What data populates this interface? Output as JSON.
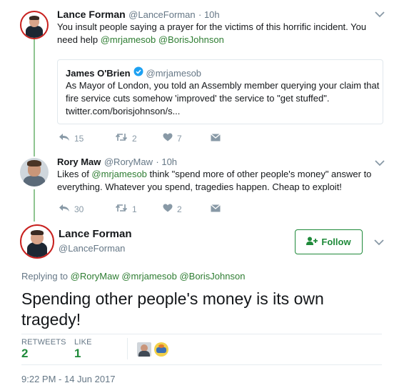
{
  "tweet1": {
    "name": "Lance Forman",
    "handle": "@LanceForman",
    "time": "· 10h",
    "text_line1": "You insult people saying a prayer for the victims of this horrific incident.  You",
    "text_line2_prefix": "need help ",
    "mention1": "@mrjamesob",
    "mention2": "@BorisJohnson",
    "quote": {
      "name": "James O'Brien",
      "handle": "@mrjamesob",
      "line1": "As Mayor of London, you told an Assembly member querying your claim that",
      "line2": "fire service cuts somehow 'improved' the service to \"get stuffed\".",
      "line3": "twitter.com/borisjohnson/s..."
    },
    "actions": {
      "replies": "15",
      "retweets": "2",
      "likes": "7"
    }
  },
  "tweet2": {
    "name": "Rory Maw",
    "handle": "@RoryMaw",
    "time": "· 10h",
    "line1_prefix": "Likes of ",
    "mention": "@mrjamesob",
    "line1_suffix": " think \"spend more of other people's money\" answer to",
    "line2": "everything. Whatever you spend, tragedies happen. Cheap to exploit!",
    "actions": {
      "replies": "30",
      "retweets": "1",
      "likes": "2"
    }
  },
  "main": {
    "name": "Lance Forman",
    "handle": "@LanceForman",
    "follow_label": "Follow",
    "replying_prefix": "Replying to ",
    "replying_to": "@RoryMaw @mrjamesob @BorisJohnson",
    "text_line1": "Spending other people's money is its own",
    "text_line2": "tragedy!",
    "retweets_label": "RETWEETS",
    "retweets_count": "2",
    "likes_label": "LIKE",
    "likes_count": "1",
    "timestamp": "9:22 PM - 14 Jun 2017"
  },
  "colors": {
    "accent": "#1f8a3a",
    "link": "#2e7d32",
    "muted": "#8899a6",
    "thread": "#8fc591"
  }
}
